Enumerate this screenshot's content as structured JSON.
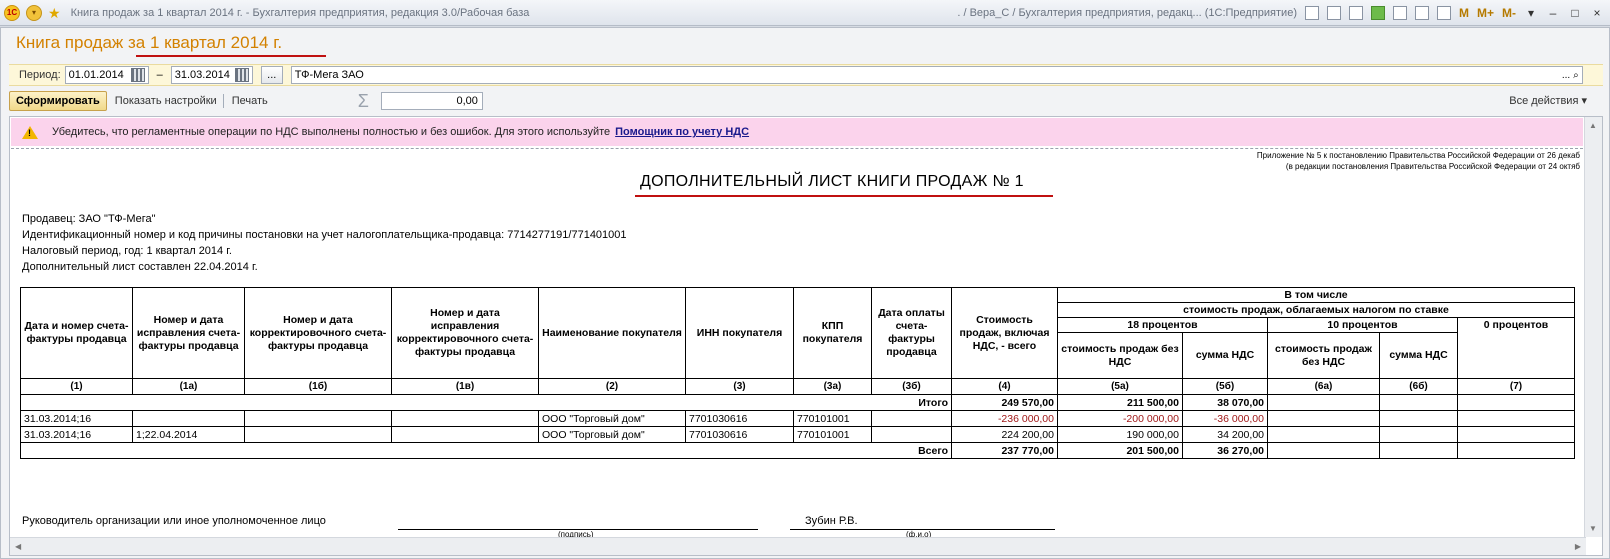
{
  "window": {
    "title": "Книга продаж за 1 квартал 2014 г. - Бухгалтерия предприятия, редакция 3.0/Рабочая база",
    "right_title": ". / Вера_С / Бухгалтерия предприятия, редакц... (1С:Предприятие)",
    "logo_text": "1С",
    "m_labels": [
      "M",
      "M+",
      "M-"
    ]
  },
  "form": {
    "title": "Книга продаж за 1 квартал 2014 г.",
    "period_label": "Период:",
    "date_from": "01.01.2014",
    "date_sep": "–",
    "date_to": "31.03.2014",
    "dots_label": "...",
    "organization": "ТФ-Мега ЗАО",
    "org_dots": "...",
    "generate_button": "Сформировать",
    "show_settings": "Показать настройки",
    "print": "Печать",
    "sigma": "Σ",
    "sum_value": "0,00",
    "all_actions": "Все действия ▾"
  },
  "warning": {
    "icon_mark": "!",
    "text": "Убедитесь, что регламентные операции по НДС выполнены полностью и без ошибок. Для этого используйте",
    "link": "Помощник по учету НДС"
  },
  "report": {
    "note_line1": "Приложение № 5 к постановлению Правительства Российской Федерации от 26 декаб",
    "note_line2": "(в редакции постановления Правительства Российской Федерации от 24 октяб",
    "title": "ДОПОЛНИТЕЛЬНЫЙ ЛИСТ КНИГИ ПРОДАЖ № 1",
    "seller": "Продавец: ЗАО \"ТФ-Мега\"",
    "inn": "Идентификационный номер и код причины постановки на учет налогоплательщика-продавца: 7714277191/771401001",
    "period": "Налоговый период, год: 1 квартал 2014 г.",
    "compiled": "Дополнительный лист составлен 22.04.2014 г.",
    "headers": {
      "c1": "Дата и номер счета-фактуры продавца",
      "c1a": "Номер и дата исправления счета-фактуры продавца",
      "c1b": "Номер и дата корректировочного счета-фактуры продавца",
      "c1v": "Номер и дата исправления корректировочного счета-фактуры продавца",
      "c2": "Наименование покупателя",
      "c3": "ИНН покупателя",
      "c3a": "КПП покупателя",
      "c3b": "Дата оплаты счета-фактуры продавца",
      "c4": "Стоимость продаж, включая НДС, - всего",
      "incl": "В том числе",
      "by_rate": "стоимость продаж, облагаемых налогом по ставке",
      "p18": "18 процентов",
      "p10": "10 процентов",
      "p0": "0 процентов",
      "c5a": "стоимость продаж без НДС",
      "c5b": "сумма НДС",
      "c6a": "стоимость продаж без НДС",
      "c6b": "сумма НДС"
    },
    "col_numbers": [
      "(1)",
      "(1а)",
      "(1б)",
      "(1в)",
      "(2)",
      "(3)",
      "(3а)",
      "(3б)",
      "(4)",
      "(5а)",
      "(5б)",
      "(6а)",
      "(6б)",
      "(7)"
    ],
    "itogo": {
      "label": "Итого",
      "c4": "249 570,00",
      "c5a": "211 500,00",
      "c5b": "38 070,00"
    },
    "rows": [
      {
        "c1": "31.03.2014;16",
        "c1a": "",
        "c2": "ООО \"Торговый дом\"",
        "c3": "7701030616",
        "c3a": "770101001",
        "c4": "-236 000,00",
        "c5a": "-200 000,00",
        "c5b": "-36 000,00"
      },
      {
        "c1": "31.03.2014;16",
        "c1a": "1;22.04.2014",
        "c2": "ООО \"Торговый дом\"",
        "c3": "7701030616",
        "c3a": "770101001",
        "c4": "224 200,00",
        "c5a": "190 000,00",
        "c5b": "34 200,00"
      }
    ],
    "vsego": {
      "label": "Всего",
      "c4": "237 770,00",
      "c5a": "201 500,00",
      "c5b": "36 270,00"
    },
    "signature_label": "Руководитель организации или иное уполномоченное лицо",
    "signature_caption": "(подпись)",
    "name": "Зубин Р.В.",
    "name_caption": "(ф.и.о)"
  }
}
